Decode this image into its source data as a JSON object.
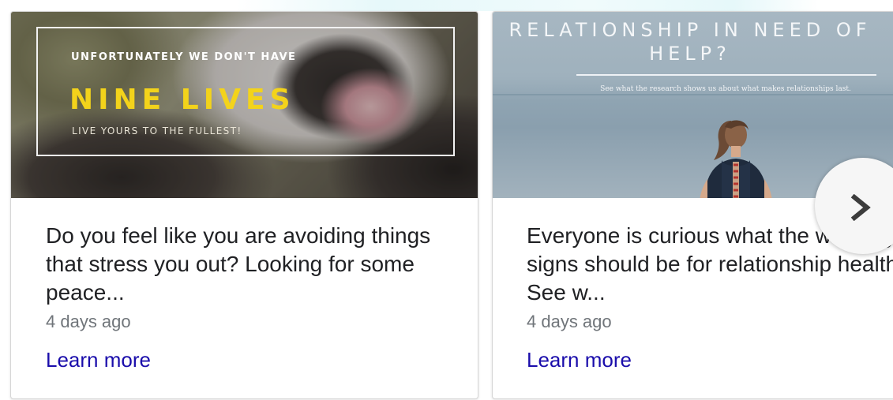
{
  "cards": [
    {
      "image": {
        "line1": "UNFORTUNATELY WE DON'T HAVE",
        "title": "NINE LIVES",
        "line3": "LIVE YOURS TO THE FULLEST!",
        "title_color": "#f3d31b"
      },
      "description": "Do you feel like you are avoiding things that stress you out? Looking for some peace...",
      "age": "4 days ago",
      "link_label": "Learn more"
    },
    {
      "image": {
        "title": "RELATIONSHIP IN NEED OF HELP?",
        "subtitle": "See what the research shows us about what makes relationships last."
      },
      "description": "Everyone is curious what the warning signs should be for relationship health. See w...",
      "age": "4 days ago",
      "link_label": "Learn more"
    }
  ],
  "carousel": {
    "next_icon": "chevron-right-icon"
  },
  "colors": {
    "link": "#1a0dab",
    "text": "#202124",
    "muted": "#70757a"
  }
}
